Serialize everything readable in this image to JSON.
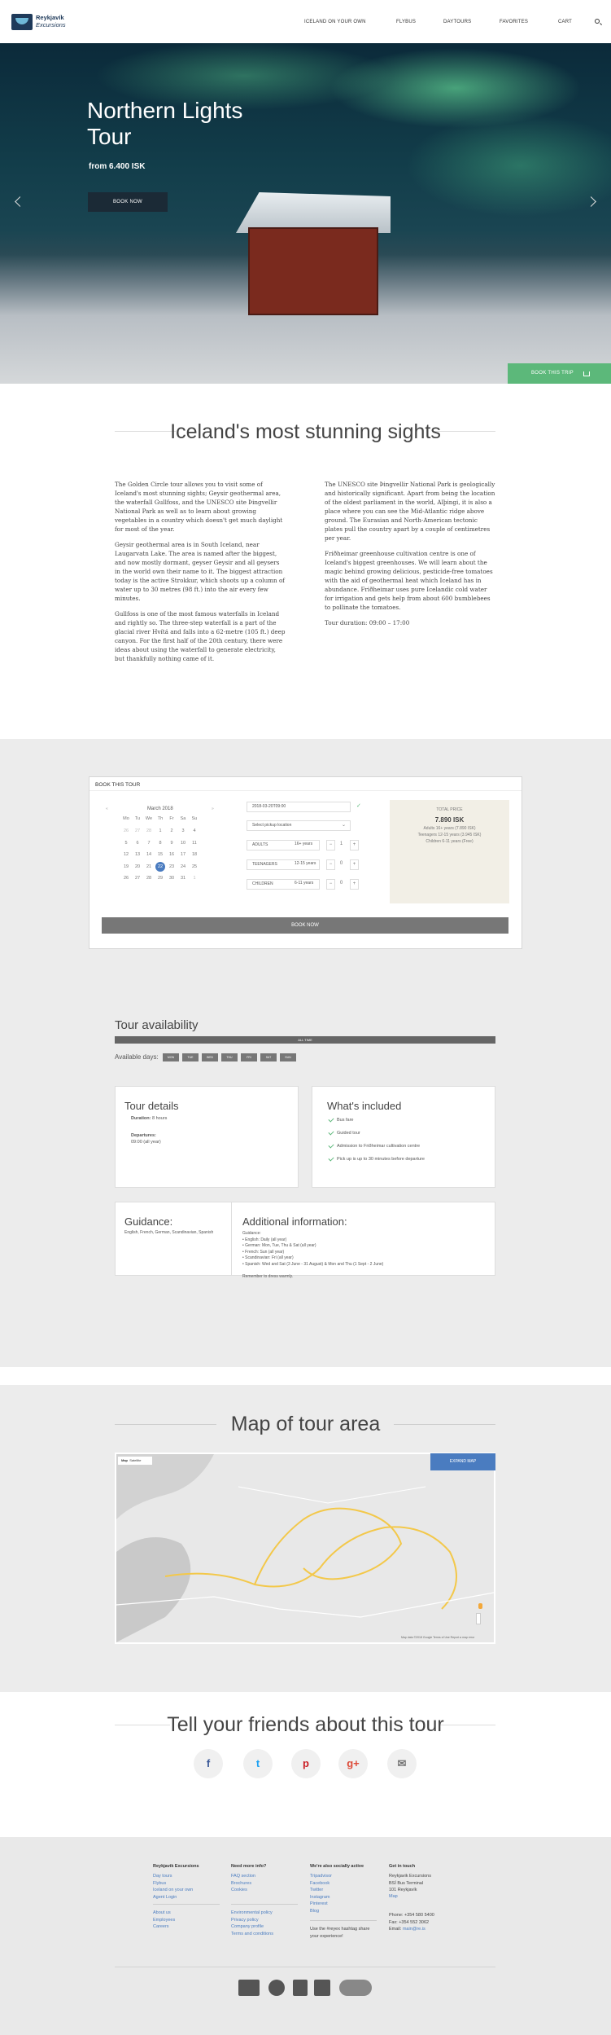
{
  "brand": {
    "name": "Reykjavík",
    "sub": "Excursions"
  },
  "nav": [
    "ICELAND ON YOUR OWN",
    "FLYBUS",
    "DAYTOURS",
    "FAVORITES",
    "CART"
  ],
  "hero": {
    "title_line1": "Northern Lights",
    "title_line2": "Tour",
    "price": "from 6.400 ISK",
    "book_now": "BOOK NOW",
    "book_trip": "BOOK THIS TRIP"
  },
  "about": {
    "title": "Iceland's most stunning sights",
    "left": [
      "The Golden Circle tour allows you to visit some of Iceland's most stunning sights; Geysir geothermal area, the waterfall Gullfoss, and the UNESCO site Þingvellir National Park as well as to learn about growing vegetables in a country which doesn't get much daylight for most of the year.",
      "Geysir geothermal area is in South Iceland, near Laugarvatn Lake. The area is named after the biggest, and now mostly dormant, geyser Geysir and all geysers in the world own their name to it. The biggest attraction today is the active Strokkur, which shoots up a column of water up to 30 metres (98 ft.) into the air every few minutes.",
      "Gullfoss is one of the most famous waterfalls in Iceland and rightly so. The three-step waterfall is a part of the glacial river Hvítá and falls into a 62-metre (105 ft.) deep canyon. For the first half of the 20th century, there were ideas about using the waterfall to generate electricity, but thankfully nothing came of it."
    ],
    "right": [
      "The UNESCO site Þingvellir National Park is geologically and historically significant. Apart from being the location of the oldest parliament in the world, Alþingi, it is also a place where you can see the Mid-Atlantic ridge above ground. The Eurasian and North-American tectonic plates pull the country apart by a couple of centimetres per year.",
      "Friðheimar greenhouse cultivation centre is one of Iceland's biggest greenhouses. We will learn about the magic behind growing delicious, pesticide-free tomatoes with the aid of geothermal heat which Iceland has in abundance. Friðheimar uses pure Icelandic cold water for irrigation and gets help from about 600 bumblebees to pollinate the tomatoes.",
      "Tour duration: 09:00 – 17:00"
    ]
  },
  "booking": {
    "heading": "BOOK THIS TOUR",
    "month": "March 2018",
    "weekdays": [
      "Mo",
      "Tu",
      "We",
      "Th",
      "Fr",
      "Sa",
      "Su"
    ],
    "days": [
      "26",
      "27",
      "28",
      "1",
      "2",
      "3",
      "4",
      "5",
      "6",
      "7",
      "8",
      "9",
      "10",
      "11",
      "12",
      "13",
      "14",
      "15",
      "16",
      "17",
      "18",
      "19",
      "20",
      "21",
      "22",
      "23",
      "24",
      "25",
      "26",
      "27",
      "28",
      "29",
      "30",
      "31",
      "1"
    ],
    "selected_day": "20",
    "date_value": "2018-03-20T09:00",
    "pickup_placeholder": "Select pickup location",
    "rows": [
      {
        "label": "ADULTS",
        "age": "16+ years",
        "qty": "1"
      },
      {
        "label": "TEENAGERS",
        "age": "12-15 years",
        "qty": "0"
      },
      {
        "label": "CHILDREN",
        "age": "6-11 years",
        "qty": "0"
      }
    ],
    "total_label": "TOTAL PRICE",
    "total": "7.890 ISK",
    "breakdown": [
      "Adults 16+ years (7.890 ISK)",
      "Teenagers 12-15 years (3.945 ISK)",
      "Children 6-11 years (Free)"
    ],
    "book_now": "BOOK NOW"
  },
  "availability": {
    "title": "Tour availability",
    "all_time": "ALL TIME",
    "days_label": "Available days:",
    "days": [
      "MON",
      "TUE",
      "WED",
      "THU",
      "FRI",
      "SAT",
      "SUN"
    ]
  },
  "details": {
    "title": "Tour details",
    "duration_label": "Duration:",
    "duration": "8 hours",
    "departures_label": "Departures:",
    "departures": "09:00 (all year)"
  },
  "included": {
    "title": "What's included",
    "items": [
      "Bus fare",
      "Guided tour",
      "Admission to Friðheimar cultivation centre",
      "Pick up is up to 30 minutes before departure"
    ]
  },
  "guidance": {
    "title": "Guidance:",
    "text": "English, French, German, Scandinavian, Spanish"
  },
  "additional": {
    "title": "Additional information:",
    "lines": [
      "Guidance:",
      "• English: Daily (all year)",
      "• German: Mon, Tue, Thu & Sat (all year)",
      "• French: Sun (all year)",
      "• Scandinavian: Fri (all year)",
      "• Spanish: Wed and Sat (3 June - 31 August) & Mon and Thu (1 Sept - 2 June)",
      "",
      "Remember to dress warmly."
    ]
  },
  "map": {
    "title": "Map of tour area",
    "tab_map": "Map",
    "tab_sat": "Satellite",
    "expand": "EXPAND MAP",
    "credit": "Map data ©2018 Google   Terms of Use   Report a map error"
  },
  "share": {
    "title": "Tell your friends about this tour",
    "icons": [
      "f",
      "t",
      "p",
      "g+",
      "✉"
    ]
  },
  "footer": {
    "col1_title": "Reykjavik Excursions",
    "col1_links": [
      "Day tours",
      "Flybus",
      "Iceland on your own",
      "Agent Login"
    ],
    "col1_links2": [
      "About us",
      "Employees",
      "Careers"
    ],
    "col2_title": "Need more info?",
    "col2_links": [
      "FAQ section",
      "Brochures",
      "Cookies"
    ],
    "col2_links2": [
      "Environmental policy",
      "Privacy policy",
      "Company profile",
      "Terms and conditions"
    ],
    "col3_title": "We're also socially active",
    "col3_links": [
      "Tripadvisor",
      "Facebook",
      "Twitter",
      "Instagram",
      "Pinterest",
      "Blog"
    ],
    "col3_text": "Use the #reyex hashtag share\nyour experience!",
    "col4_title": "Get in touch",
    "col4_text": "Reykjavik Excursions\nBSÍ Bus Terminal\n101 Reykjavík",
    "col4_map": "Map",
    "col4_phone": "Phone: +354 580 5400\nFax: +354 552 3062",
    "col4_email_label": "Email: ",
    "col4_email": "main@re.is"
  },
  "colors": {
    "accent": "#5cb87a",
    "dark": "#1b2a36",
    "link": "#4a7cc0"
  }
}
